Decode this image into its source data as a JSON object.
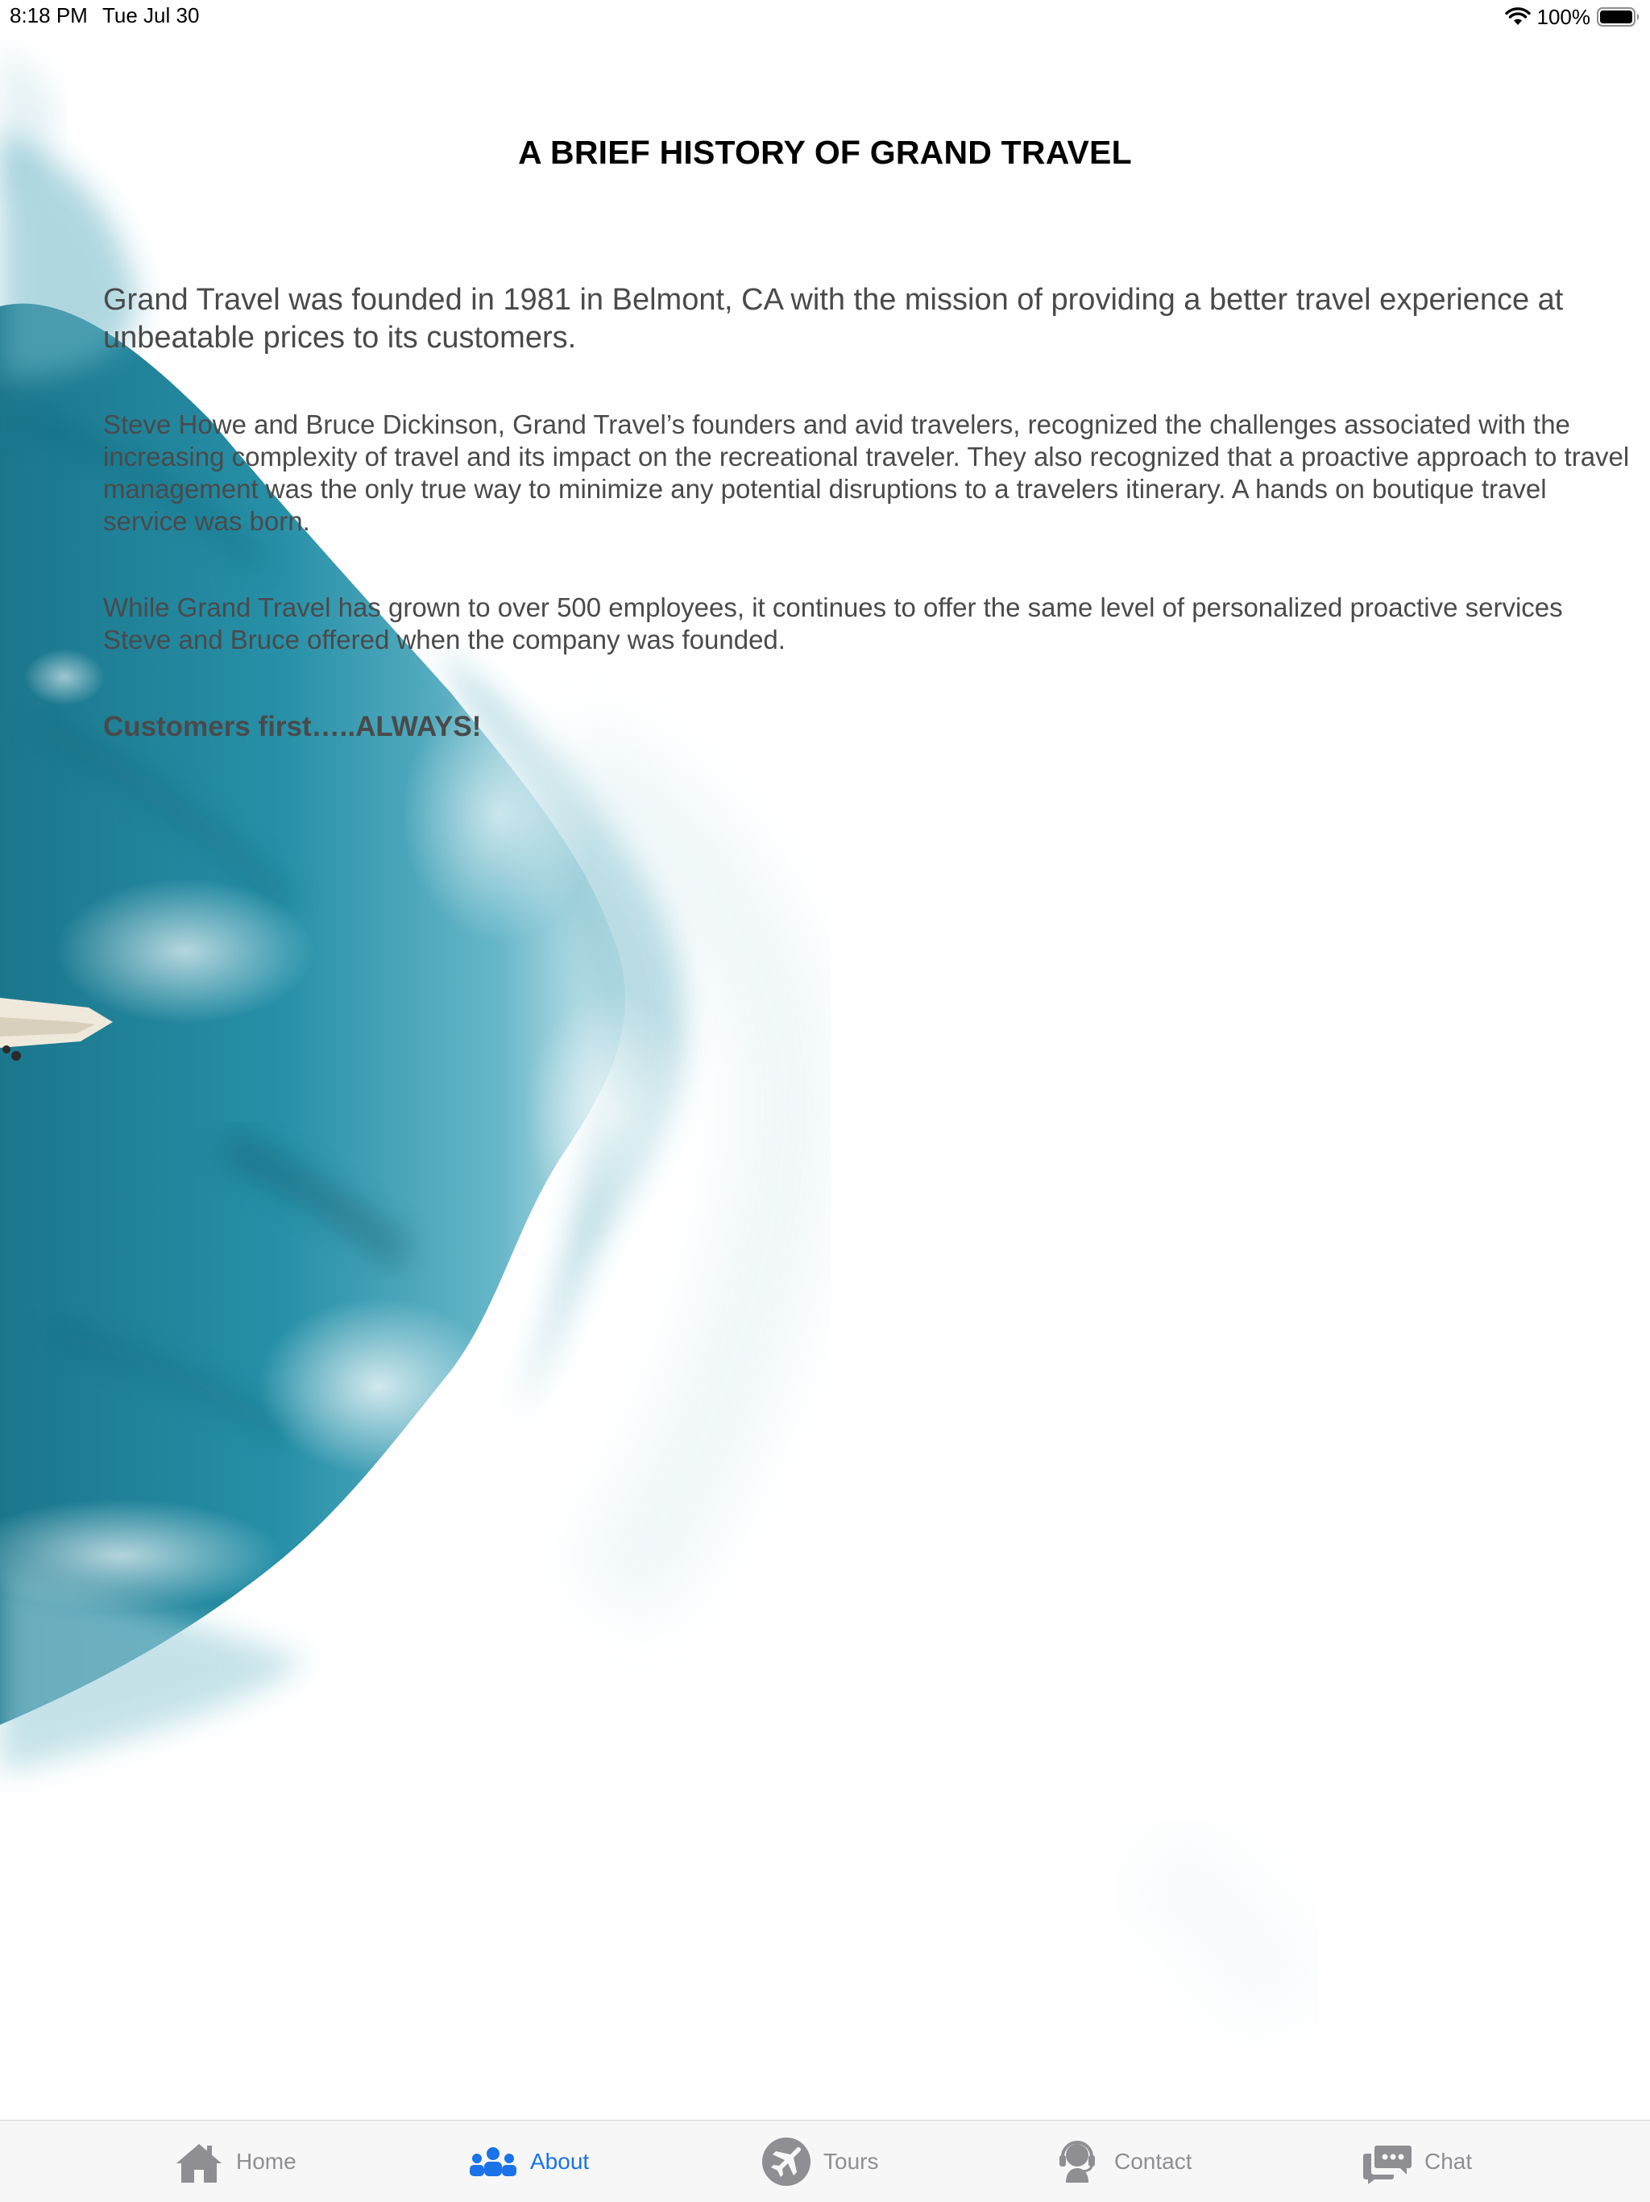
{
  "status_bar": {
    "time": "8:18 PM",
    "date": "Tue Jul 30",
    "battery_text": "100%"
  },
  "page": {
    "title": "A BRIEF HISTORY OF GRAND TRAVEL",
    "lead": "Grand Travel was founded in 1981 in Belmont, CA with the mission of providing a better travel experience at unbeatable prices to its customers.",
    "paragraph1": "Steve Howe and Bruce Dickinson, Grand Travel’s founders and avid travelers, recognized the challenges associated with the increasing complexity of travel and its impact on the recreational traveler. They also recognized that a proactive approach to travel management was the only true way to minimize any potential disruptions to a travelers itinerary. A hands on boutique travel service was born.",
    "paragraph2": "While Grand Travel has grown to over 500 employees, it continues to offer the same level of personalized proactive services Steve and Bruce offered when the company was founded.",
    "tagline": "Customers first…..ALWAYS!"
  },
  "tab_bar": {
    "active_color": "#1a73e8",
    "inactive_color": "#8e8e93",
    "tabs": [
      {
        "label": "Home",
        "icon": "home-icon"
      },
      {
        "label": "About",
        "icon": "people-icon"
      },
      {
        "label": "Tours",
        "icon": "airplane-icon"
      },
      {
        "label": "Contact",
        "icon": "headset-icon"
      },
      {
        "label": "Chat",
        "icon": "chat-bubbles-icon"
      }
    ],
    "selected": "About"
  }
}
